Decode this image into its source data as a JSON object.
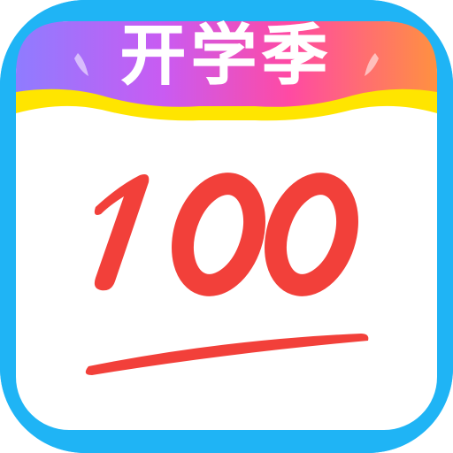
{
  "app_icon": {
    "banner_text": "开学季",
    "score_text": "100",
    "colors": {
      "background": "#1fb4f5",
      "card": "#ffffff",
      "banner_gradient": [
        "#8f7cff",
        "#c95bf2",
        "#ff4aa3",
        "#ff9140"
      ],
      "banner_yellow": "#ffe500",
      "score_red": "#f2403a"
    }
  }
}
